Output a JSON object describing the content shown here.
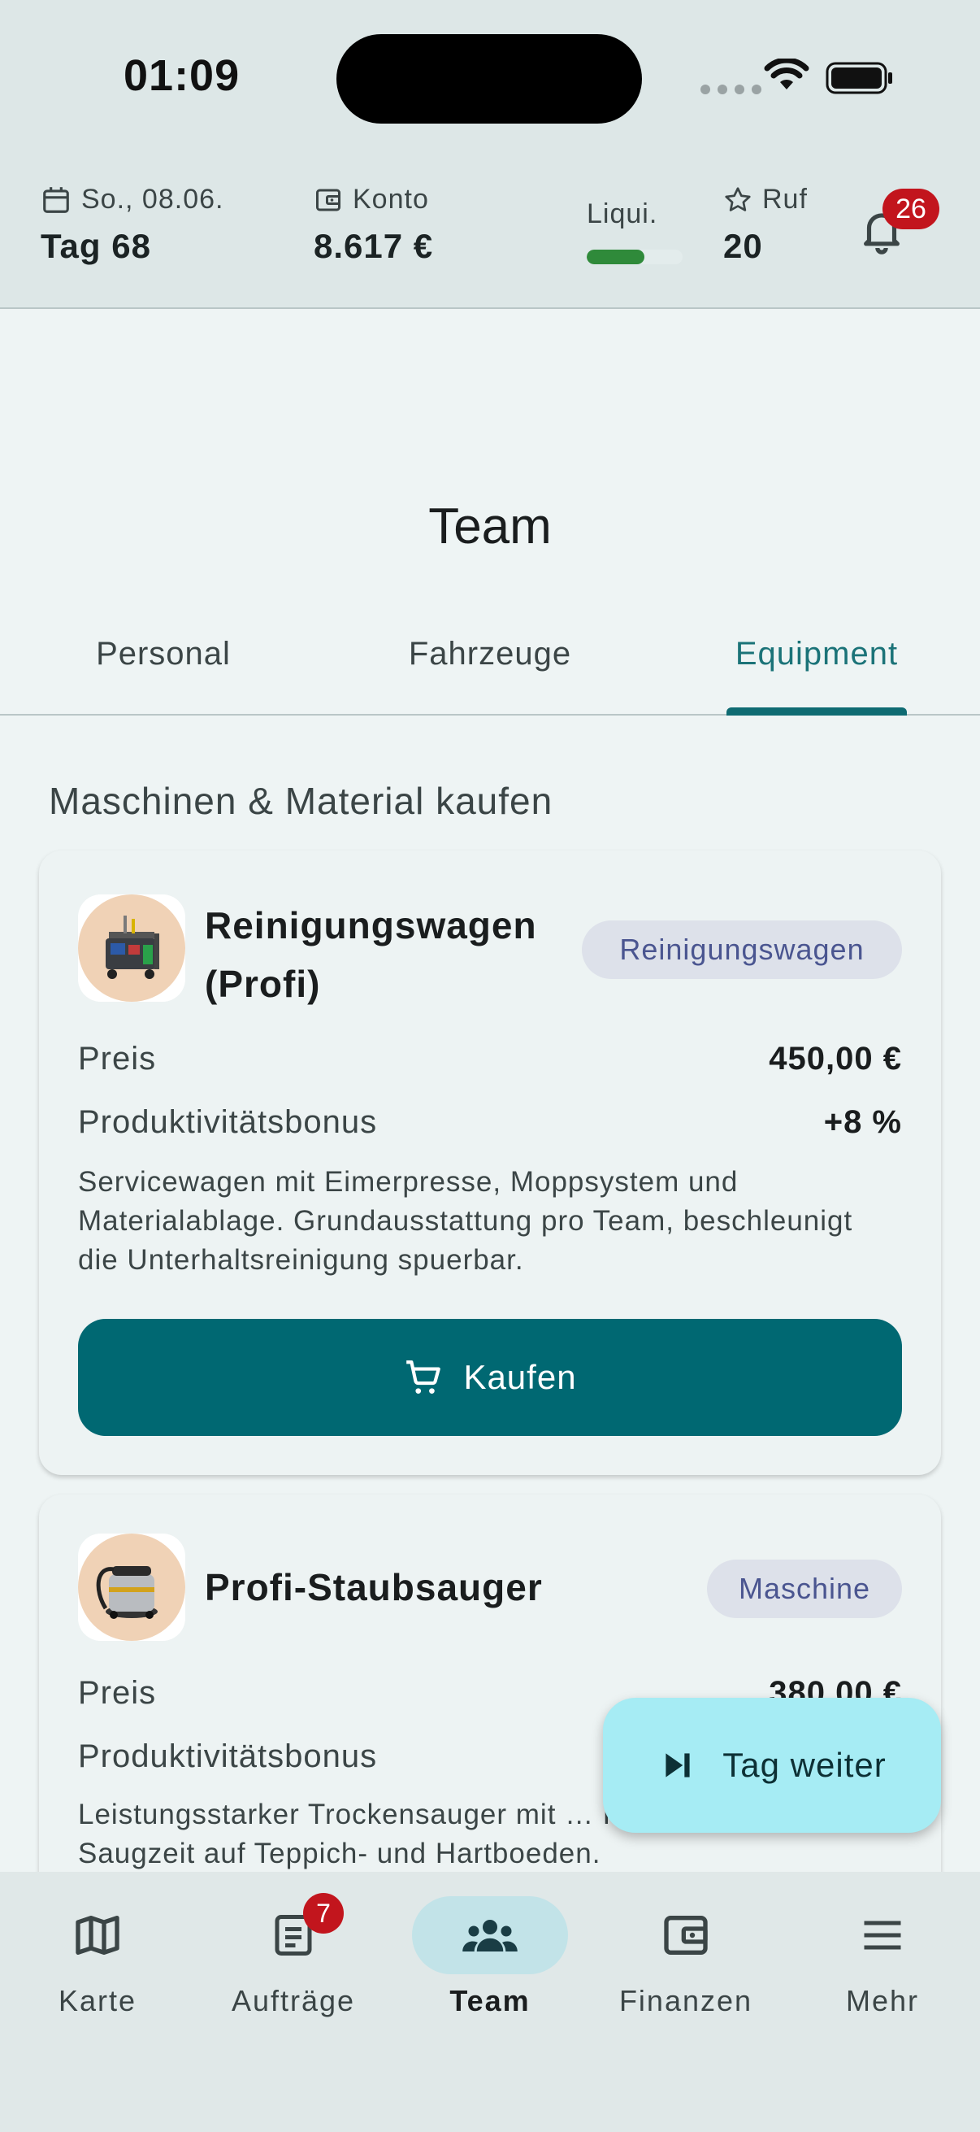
{
  "status_bar": {
    "time": "01:09"
  },
  "header": {
    "date_label": "So., 08.06.",
    "day_value": "Tag 68",
    "account_label": "Konto",
    "account_value": "8.617 €",
    "liquidity_label": "Liqui.",
    "liquidity_level": 0.6,
    "reputation_label": "Ruf",
    "reputation_value": "20",
    "notifications_count": "26"
  },
  "page": {
    "title": "Team"
  },
  "tabs": [
    {
      "label": "Personal",
      "active": false
    },
    {
      "label": "Fahrzeuge",
      "active": false
    },
    {
      "label": "Equipment",
      "active": true
    }
  ],
  "section": {
    "title": "Maschinen & Material kaufen"
  },
  "items": [
    {
      "name_line1": "Reinigungswagen",
      "name_line2": "(Profi)",
      "category": "Reinigungswagen",
      "price_label": "Preis",
      "price": "450,00 €",
      "bonus_label": "Produktivitätsbonus",
      "bonus": "+8 %",
      "description": "Servicewagen mit Eimerpresse, Moppsystem und Materialablage. Grundausstattung pro Team, beschleunigt die Unterhaltsreinigung spuerbar.",
      "buy_label": "Kaufen"
    },
    {
      "name_line1": "Profi-Staubsauger",
      "category": "Maschine",
      "price_label": "Preis",
      "price": "380,00 €",
      "bonus_label": "Produktivitätsbonus",
      "description": "Leistungsstarker Trockensauger mit … Reduziert die Saugzeit auf Teppich- und Hartboeden."
    }
  ],
  "fab": {
    "label": "Tag weiter"
  },
  "bottom_nav": [
    {
      "label": "Karte",
      "icon": "map-icon"
    },
    {
      "label": "Aufträge",
      "icon": "document-icon",
      "badge": "7"
    },
    {
      "label": "Team",
      "icon": "group-icon",
      "active": true
    },
    {
      "label": "Finanzen",
      "icon": "wallet-icon"
    },
    {
      "label": "Mehr",
      "icon": "menu-icon"
    }
  ],
  "colors": {
    "primary": "#006872",
    "accent_tab": "#1b7378",
    "badge": "#c2151d",
    "fab": "#a6ecf4",
    "chip_bg": "#dde1ea",
    "liquidity": "#2f8a3a"
  }
}
